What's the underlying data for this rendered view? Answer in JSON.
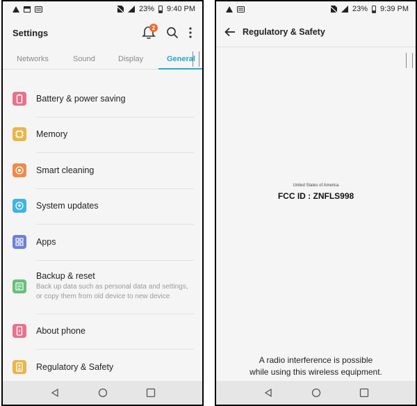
{
  "left_screen": {
    "status": {
      "battery": "23%",
      "time": "9:40 PM"
    },
    "header": {
      "title": "Settings",
      "notification_count": "2"
    },
    "tabs": [
      {
        "label": "Networks"
      },
      {
        "label": "Sound"
      },
      {
        "label": "Display"
      },
      {
        "label": "General",
        "selected": true
      }
    ],
    "items": [
      {
        "label": "Battery & power saving",
        "icon": "battery-icon",
        "color": "#e5738e"
      },
      {
        "label": "Memory",
        "icon": "memory-chip-icon",
        "color": "#e8b64a"
      },
      {
        "label": "Smart cleaning",
        "icon": "smart-cleaning-icon",
        "color": "#ef8a4a"
      },
      {
        "label": "System updates",
        "icon": "system-update-icon",
        "color": "#3fb3e3"
      },
      {
        "label": "Apps",
        "icon": "apps-grid-icon",
        "color": "#6e7fd9"
      },
      {
        "label": "Backup & reset",
        "sub": "Back up data such as personal data and settings, or copy them from old device to new device",
        "icon": "backup-icon",
        "color": "#66c07a"
      },
      {
        "label": "About phone",
        "icon": "phone-icon",
        "color": "#e5738e"
      },
      {
        "label": "Regulatory & Safety",
        "icon": "regulatory-icon",
        "color": "#e8b64a"
      }
    ]
  },
  "right_screen": {
    "status": {
      "battery": "23%",
      "time": "9:39 PM"
    },
    "header": {
      "title": "Regulatory & Safety"
    },
    "fcc": {
      "country": "United States of America",
      "id_text": "FCC ID : ZNFLS998"
    },
    "note": {
      "line1": "A radio interference is possible",
      "line2": "while using this wireless equipment."
    }
  },
  "colors": {
    "accent": "#29a8c8",
    "badge": "#ef6c2a"
  }
}
